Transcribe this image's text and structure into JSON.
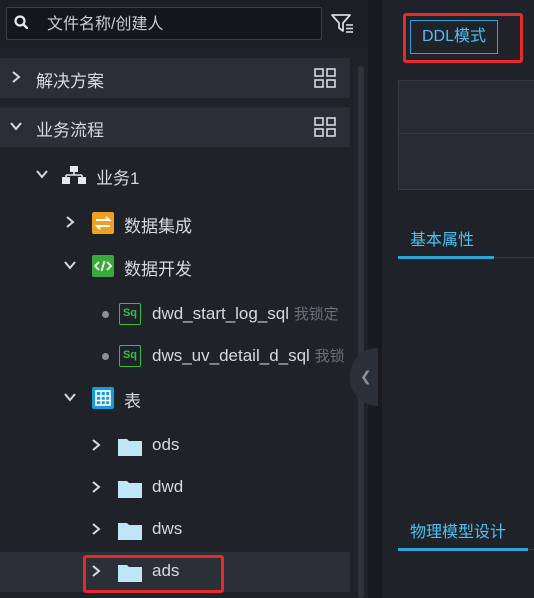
{
  "search": {
    "placeholder": "文件名称/创建人"
  },
  "tree": {
    "solutions_label": "解决方案",
    "workflow_label": "业务流程",
    "business1_label": "业务1",
    "data_integration_label": "数据集成",
    "data_dev_label": "数据开发",
    "node1": {
      "name": "dwd_start_log_sql",
      "lock": "我锁定"
    },
    "node2": {
      "name": "dws_uv_detail_d_sql",
      "lock": "我锁"
    },
    "sq_label": "Sq",
    "table_label": "表",
    "folders": [
      "ods",
      "dwd",
      "dws",
      "ads"
    ]
  },
  "right": {
    "ddl_button": "DDL模式",
    "tab_basic": "基本属性",
    "tab_physical": "物理模型设计"
  },
  "colors": {
    "accent": "#2aa5d8",
    "highlight": "#e8292a",
    "sql_green": "#2fbf47",
    "folder": "#bfe6f7"
  }
}
